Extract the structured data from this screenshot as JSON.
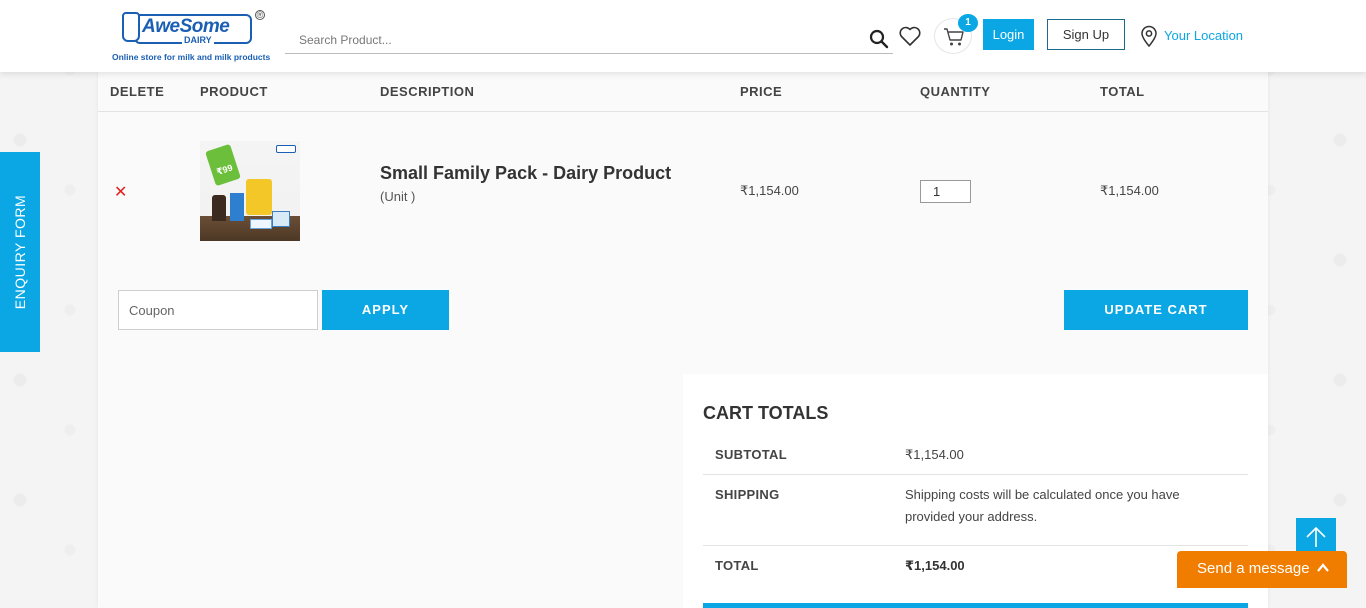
{
  "header": {
    "logo": {
      "brand": "AweSome",
      "sub_brand": "DAIRY",
      "tagline": "Online store for milk and milk products",
      "registered_mark": "®"
    },
    "search": {
      "placeholder": "Search Product..."
    },
    "cart_count": "1",
    "login_label": "Login",
    "signup_label": "Sign Up",
    "location_label": "Your Location"
  },
  "cart_table": {
    "columns": [
      "DELETE",
      "PRODUCT",
      "DESCRIPTION",
      "PRICE",
      "QUANTITY",
      "TOTAL"
    ],
    "items": [
      {
        "delete_symbol": "✕",
        "image_tag_text": "₹99",
        "name": "Small Family Pack - Dairy Product",
        "unit": "(Unit )",
        "price": "₹1,154.00",
        "quantity": "1",
        "total": "₹1,154.00"
      }
    ]
  },
  "coupon": {
    "placeholder": "Coupon",
    "apply_label": "APPLY"
  },
  "update_cart_label": "UPDATE CART",
  "cart_totals": {
    "title": "CART TOTALS",
    "subtotal_label": "SUBTOTAL",
    "subtotal_value": "₹1,154.00",
    "shipping_label": "SHIPPING",
    "shipping_text": "Shipping costs will be calculated once you have provided your address.",
    "total_label": "TOTAL",
    "total_value": "₹1,154.00"
  },
  "enquiry_label": "ENQUIRY FORM",
  "send_message_label": "Send a message",
  "colors": {
    "accent": "#0aa7e4",
    "chat": "#f07d00",
    "delete": "#e02020",
    "brand": "#1a5fb4"
  },
  "icons": [
    "search-icon",
    "heart-icon",
    "cart-icon",
    "location-pin-icon",
    "arrow-up-icon",
    "chevron-up-icon",
    "close-icon"
  ]
}
